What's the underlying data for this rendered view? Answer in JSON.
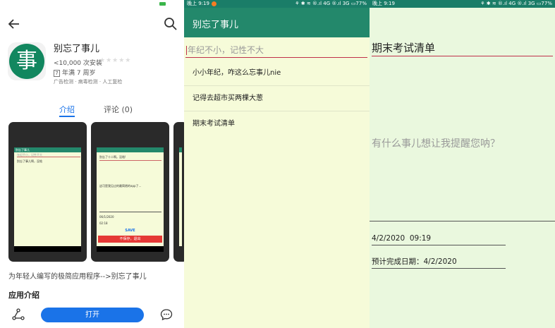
{
  "store": {
    "app_icon_char": "事",
    "app_name": "别忘了事儿",
    "installs": "<10,000 次安装",
    "stars": "★★★★★",
    "age_badge": "7",
    "age_text": "年满 7 周岁",
    "checks": "广告检测 · 病毒检测 · 人工复检",
    "tabs": [
      {
        "label": "介绍"
      },
      {
        "label": "评论 (0)"
      }
    ],
    "screenshot1": {
      "search_hint": "年纪不小，记性不大",
      "appbar": "别忘了事儿",
      "item": "别忘了事儿啊，没啥"
    },
    "screenshot2": {
      "line1": "别忘了十二啊。没啥!",
      "line2": "这可是我见过的最简陋的app了...",
      "date": "06/1/2020",
      "date2": "02:18",
      "save": "SAVE",
      "delete": "不保存，退出"
    },
    "description": "为年轻人编写的极简应用程序-->别忘了事儿",
    "section_title": "应用介绍",
    "open_label": "打开"
  },
  "list_screen": {
    "status_time": "晚上 9:19",
    "status_icons": "⚘ ✱ ≋ ®.ıl 4G ®.ıl 3G ▭77%",
    "title": "别忘了事儿",
    "search_placeholder": "年纪不小，记性不大",
    "items": [
      {
        "label": "小小年纪，咋这么忘事儿nie"
      },
      {
        "label": "记得去超市买两棵大葱"
      },
      {
        "label": "期末考试清单"
      }
    ]
  },
  "edit_screen": {
    "status_time": "晚上 9:19",
    "status_icons": "⚘ ✱ ≋ ®.ıl 4G ®.ıl 3G ▭77%",
    "title_value": "期末考试清单",
    "body_placeholder": "有什么事儿想让我提醒您呐？",
    "created_datetime": "4/2/2020  09:19",
    "due_label": "预计完成日期：",
    "due_date": "4/2/2020"
  },
  "colors": {
    "brand_green": "#23886b",
    "accent_red": "#c0304a",
    "store_blue": "#1a73e8"
  }
}
